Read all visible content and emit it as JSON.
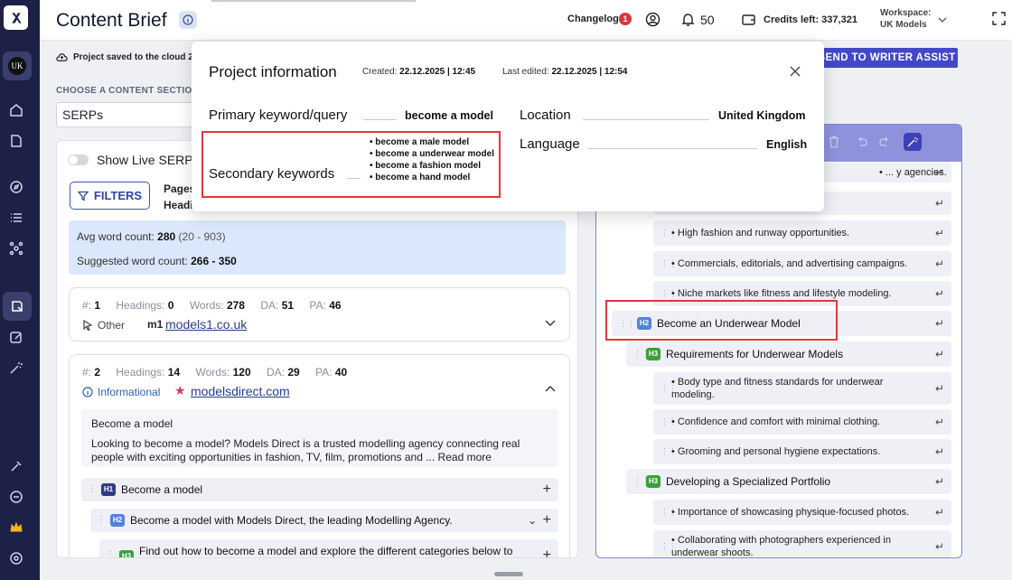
{
  "header": {
    "title": "Content Brief",
    "changelog_label": "Changelog",
    "changelog_count": "1",
    "notifications_count": "50",
    "credits": "Credits left: 337,321",
    "workspace_label": "Workspace:",
    "workspace_value": "UK Models"
  },
  "sidebar": {
    "avatar_text": "UK"
  },
  "savebar": {
    "status": "Project saved to the cloud 2",
    "send_button": "SEND TO WRITER ASSIST"
  },
  "section": {
    "label": "CHOOSE A CONTENT SECTION",
    "value": "SERPs"
  },
  "left_panel": {
    "live_serps_label": "Show Live SERPs",
    "filters_label": "FILTERS",
    "pages_label": "Pages",
    "headings_label": "Headi",
    "avg_word_label": "Avg word count:",
    "avg_word_value": "280",
    "avg_word_range": "(20 - 903)",
    "suggested_label": "Suggested word count:",
    "suggested_value": "266 - 350",
    "results": [
      {
        "rank": "1",
        "headings": "0",
        "words": "278",
        "da": "51",
        "pa": "46",
        "intent": "Other",
        "site": "models1.co.uk"
      },
      {
        "rank": "2",
        "headings": "14",
        "words": "120",
        "da": "29",
        "pa": "40",
        "intent": "Informational",
        "site": "modelsdirect.com",
        "snippet_title": "Become a model",
        "snippet_body": "Looking to become a model? Models Direct is a trusted modelling agency connecting real people with exciting opportunities in fashion, TV, film, promotions and ... Read more",
        "headings_list": [
          {
            "level": "H1",
            "text": "Become a model"
          },
          {
            "level": "H2",
            "text": "Become a model with Models Direct, the leading Modelling Agency."
          },
          {
            "level": "H3",
            "text": "Find out how to become a model and explore the different categories below to"
          }
        ]
      }
    ],
    "stat_labels": {
      "rank": "#:",
      "headings": "Headings:",
      "words": "Words:",
      "da": "DA:",
      "pa": "PA:"
    }
  },
  "outline": {
    "rows": [
      {
        "type": "bullet",
        "text": "• ... y agencies."
      },
      {
        "type": "bullet",
        "text": ""
      },
      {
        "type": "bullet",
        "text": "• High fashion and runway opportunities."
      },
      {
        "type": "bullet",
        "text": "• Commercials, editorials, and advertising campaigns."
      },
      {
        "type": "bullet",
        "text": "• Niche markets like fitness and lifestyle modeling."
      },
      {
        "type": "heading",
        "level": "H2",
        "text": "Become an Underwear Model"
      },
      {
        "type": "heading",
        "level": "H3",
        "text": "Requirements for Underwear Models"
      },
      {
        "type": "bullet",
        "text": "• Body type and fitness standards for underwear modeling."
      },
      {
        "type": "bullet",
        "text": "• Confidence and comfort with minimal clothing."
      },
      {
        "type": "bullet",
        "text": "• Grooming and personal hygiene expectations."
      },
      {
        "type": "heading",
        "level": "H3",
        "text": "Developing a Specialized Portfolio"
      },
      {
        "type": "bullet",
        "text": "• Importance of showcasing physique-focused photos."
      },
      {
        "type": "bullet",
        "text": "• Collaborating with photographers experienced in underwear shoots."
      }
    ]
  },
  "popup": {
    "title": "Project information",
    "created_label": "Created:",
    "created_value": "22.12.2025 | 12:45",
    "edited_label": "Last edited:",
    "edited_value": "22.12.2025 | 12:54",
    "primary_label": "Primary keyword/query",
    "primary_value": "become a model",
    "secondary_label": "Secondary keywords",
    "secondary_values": [
      "• become a male model",
      "• become a underwear model",
      "• become a fashion model",
      "• become a hand model"
    ],
    "location_label": "Location",
    "location_value": "United Kingdom",
    "language_label": "Language",
    "language_value": "English"
  },
  "colors": {
    "rail": "#1d2148",
    "accent": "#4348c8",
    "highlight": "#e0373f",
    "h1": "#2f3c84",
    "h2": "#5584d6",
    "h3": "#3aa03a"
  }
}
